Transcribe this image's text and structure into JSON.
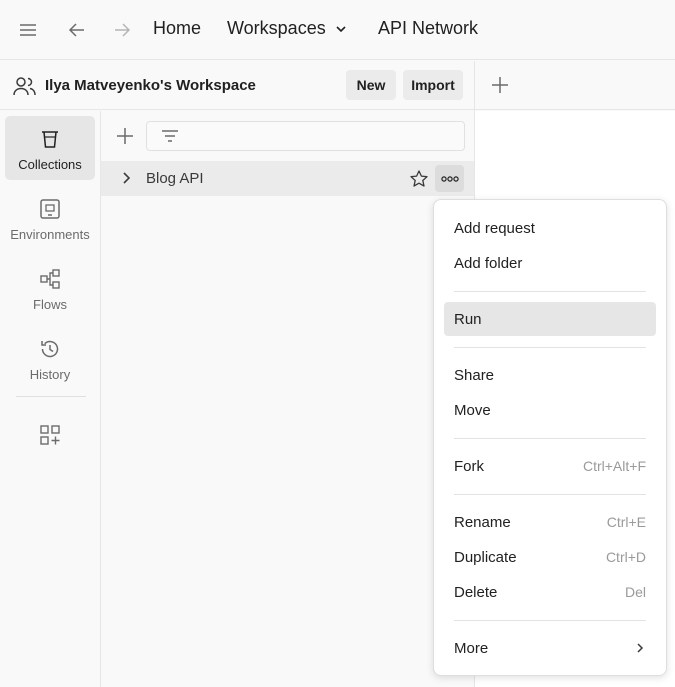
{
  "topbar": {
    "home": "Home",
    "workspaces": "Workspaces",
    "api_network": "API Network"
  },
  "workspace": {
    "name": "Ilya Matveyenko's Workspace",
    "new_label": "New",
    "import_label": "Import"
  },
  "sidebar": {
    "items": [
      {
        "label": "Collections",
        "icon": "trash-can-icon",
        "active": true
      },
      {
        "label": "Environments",
        "icon": "environment-icon",
        "active": false
      },
      {
        "label": "Flows",
        "icon": "flows-icon",
        "active": false
      },
      {
        "label": "History",
        "icon": "history-icon",
        "active": false
      }
    ]
  },
  "collections": {
    "items": [
      {
        "name": "Blog API"
      }
    ]
  },
  "context_menu": {
    "items": [
      {
        "label": "Add request",
        "shortcut": ""
      },
      {
        "label": "Add folder",
        "shortcut": ""
      },
      {
        "label": "Run",
        "shortcut": "",
        "highlighted": true
      },
      {
        "label": "Share",
        "shortcut": ""
      },
      {
        "label": "Move",
        "shortcut": ""
      },
      {
        "label": "Fork",
        "shortcut": "Ctrl+Alt+F"
      },
      {
        "label": "Rename",
        "shortcut": "Ctrl+E"
      },
      {
        "label": "Duplicate",
        "shortcut": "Ctrl+D"
      },
      {
        "label": "Delete",
        "shortcut": "Del"
      },
      {
        "label": "More",
        "shortcut": ""
      }
    ]
  },
  "colors": {
    "background": "#f9f9f9",
    "panel": "#ffffff",
    "active_item": "#e6e6e6",
    "text": "#212121",
    "muted_text": "#6b6b6b",
    "shortcut_text": "#9a9a9a"
  }
}
